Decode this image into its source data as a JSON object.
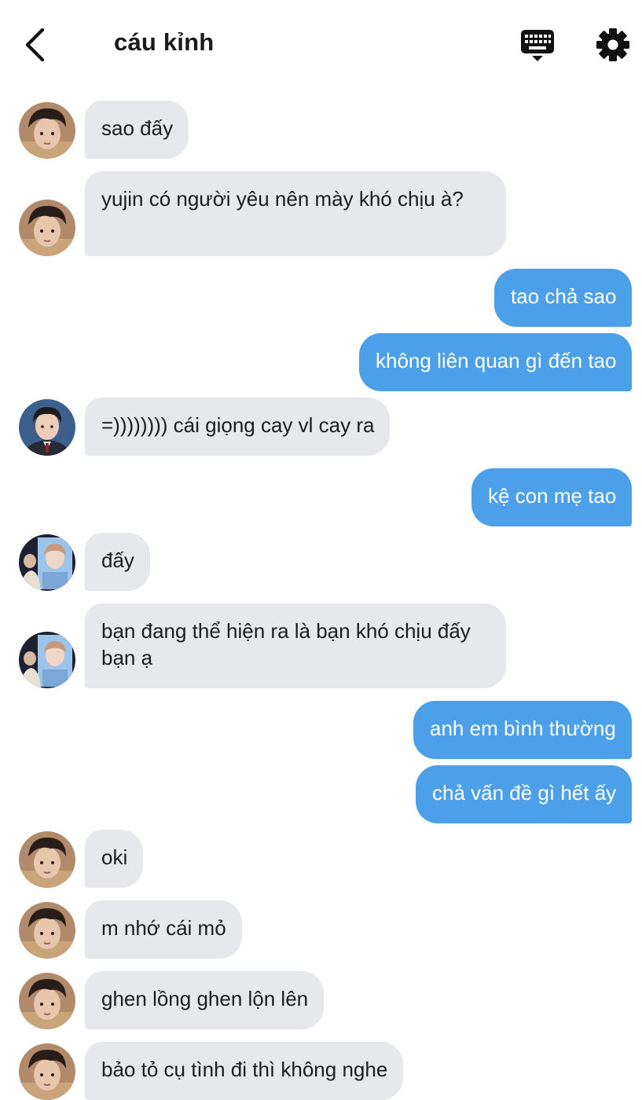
{
  "header": {
    "title": "cáu kỉnh",
    "back_icon": "chevron-left-icon",
    "keyboard_icon": "keyboard-icon",
    "settings_icon": "gear-icon"
  },
  "colors": {
    "incoming_bubble": "#e6e8ec",
    "outgoing_bubble": "#4ca0e9",
    "title": "#1a1a1a"
  },
  "messages": [
    {
      "side": "in",
      "avatar": "avatar-boy-1",
      "text": "sao đấy"
    },
    {
      "side": "in",
      "avatar": "avatar-boy-1",
      "text": "yujin có người yêu nên mày khó chịu à?"
    },
    {
      "side": "out",
      "text": "tao chả sao"
    },
    {
      "side": "out",
      "text": "không liên quan gì đến tao"
    },
    {
      "side": "in",
      "avatar": "avatar-boy-2",
      "text": "=)))))))) cái giọng cay vl cay ra"
    },
    {
      "side": "out",
      "text": "kệ con mẹ tao"
    },
    {
      "side": "in",
      "avatar": "avatar-poster",
      "text": "đấy"
    },
    {
      "side": "in",
      "avatar": "avatar-poster",
      "text": "bạn đang thể hiện ra là bạn khó chịu đấy bạn ạ"
    },
    {
      "side": "out",
      "text": "anh em bình thường"
    },
    {
      "side": "out",
      "text": "chả vấn đề gì hết ấy"
    },
    {
      "side": "in",
      "avatar": "avatar-boy-1",
      "text": "oki"
    },
    {
      "side": "in",
      "avatar": "avatar-boy-1",
      "text": "m nhớ cái mỏ"
    },
    {
      "side": "in",
      "avatar": "avatar-boy-1",
      "text": "ghen lồng ghen lộn lên"
    },
    {
      "side": "in",
      "avatar": "avatar-boy-1",
      "text": "bảo tỏ cụ tình đi thì không nghe"
    }
  ]
}
